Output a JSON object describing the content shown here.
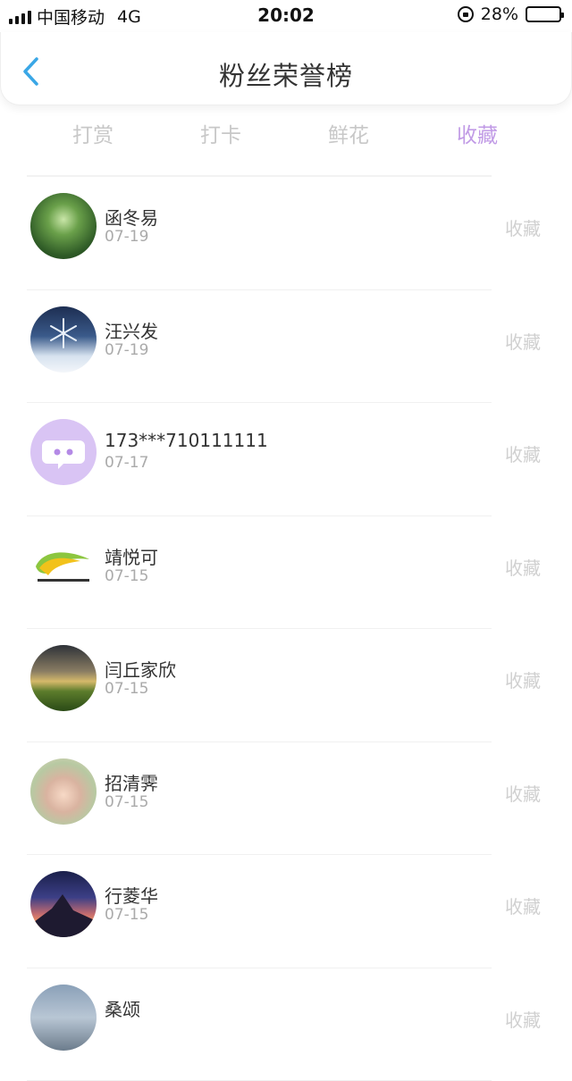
{
  "status_bar": {
    "carrier": "中国移动",
    "network": "4G",
    "time": "20:02",
    "battery": "28%",
    "battery_level": 0.28
  },
  "nav": {
    "title": "粉丝荣誉榜",
    "back_icon": "chevron-left-icon",
    "accent_color": "#3aa7e6"
  },
  "tabs": [
    {
      "label": "打赏",
      "active": false
    },
    {
      "label": "打卡",
      "active": false
    },
    {
      "label": "鲜花",
      "active": false
    },
    {
      "label": "收藏",
      "active": true
    }
  ],
  "active_tab_color": "#c19be6",
  "fans": [
    {
      "name": "函冬易",
      "date": "07-19",
      "action": "收藏"
    },
    {
      "name": "汪兴发",
      "date": "07-19",
      "action": "收藏"
    },
    {
      "name": "173***710111111",
      "date": "07-17",
      "action": "收藏"
    },
    {
      "name": "靖悦可",
      "date": "07-15",
      "action": "收藏"
    },
    {
      "name": "闫丘家欣",
      "date": "07-15",
      "action": "收藏"
    },
    {
      "name": "招清霁",
      "date": "07-15",
      "action": "收藏"
    },
    {
      "name": "行菱华",
      "date": "07-15",
      "action": "收藏"
    },
    {
      "name": "桑颂",
      "date": "",
      "action": "收藏"
    }
  ]
}
